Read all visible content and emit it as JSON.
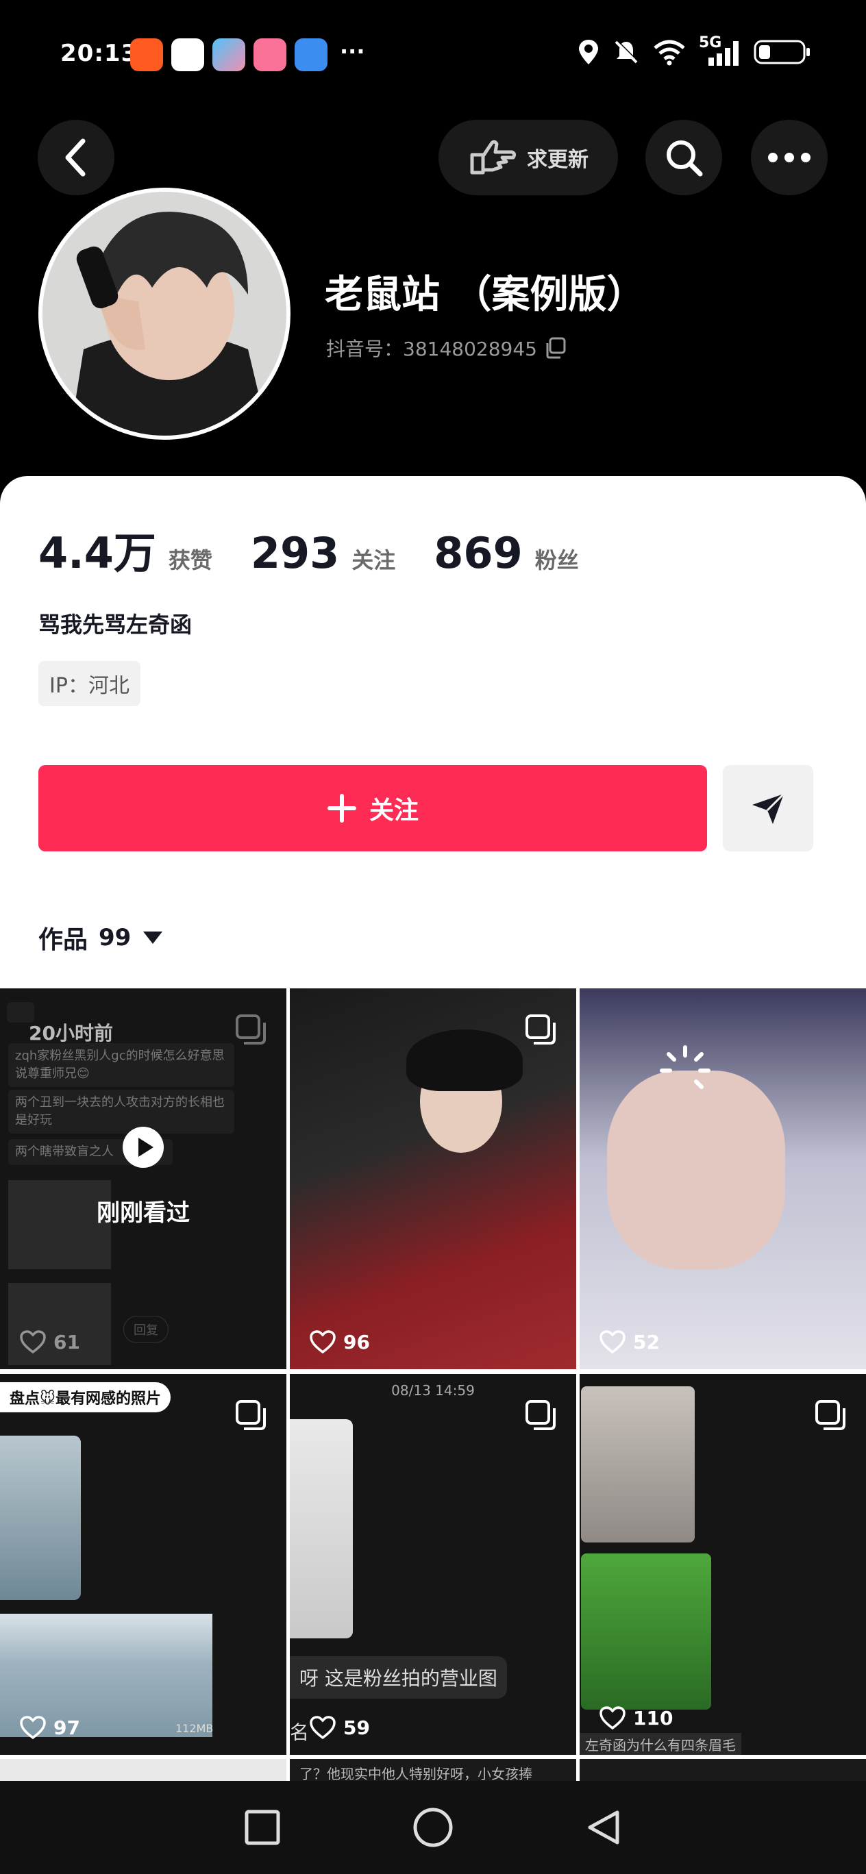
{
  "status": {
    "time": "20:13",
    "more": "···",
    "network": "5G",
    "sim": "6"
  },
  "header": {
    "update_label": "求更新"
  },
  "profile": {
    "name": "老鼠站 （案例版）",
    "douyin_id": "抖音号：38148028945",
    "stats": [
      {
        "value": "4.4万",
        "label": "获赞"
      },
      {
        "value": "293",
        "label": "关注"
      },
      {
        "value": "869",
        "label": "粉丝"
      }
    ],
    "bio": "骂我先骂左奇函",
    "ip": "IP：河北",
    "follow_label": "关注",
    "works_label": "作品",
    "works_count": "99"
  },
  "videos": [
    {
      "likes": "61",
      "overlay": "20小时前",
      "watched": "刚刚看过",
      "comments": [
        "zqh家粉丝黑别人gc的时候怎么好意思说尊重师兄😊",
        "两个丑到一块去的人攻击对方的长相也是好玩",
        "两个瞎带致盲之人"
      ],
      "reply": "回复"
    },
    {
      "likes": "96"
    },
    {
      "likes": "52"
    },
    {
      "likes": "97",
      "banner": "盘点🐭最有网感的照片",
      "size": "112MB"
    },
    {
      "likes": "59",
      "timestamp": "08/13 14:59",
      "caption": "呀 这是粉丝拍的营业图",
      "caption2": "名"
    },
    {
      "likes": "110",
      "caption": "左奇函为什么有四条眉毛"
    }
  ],
  "row3_caption": "了？他现实中他人特别好呀，小女孩捧"
}
